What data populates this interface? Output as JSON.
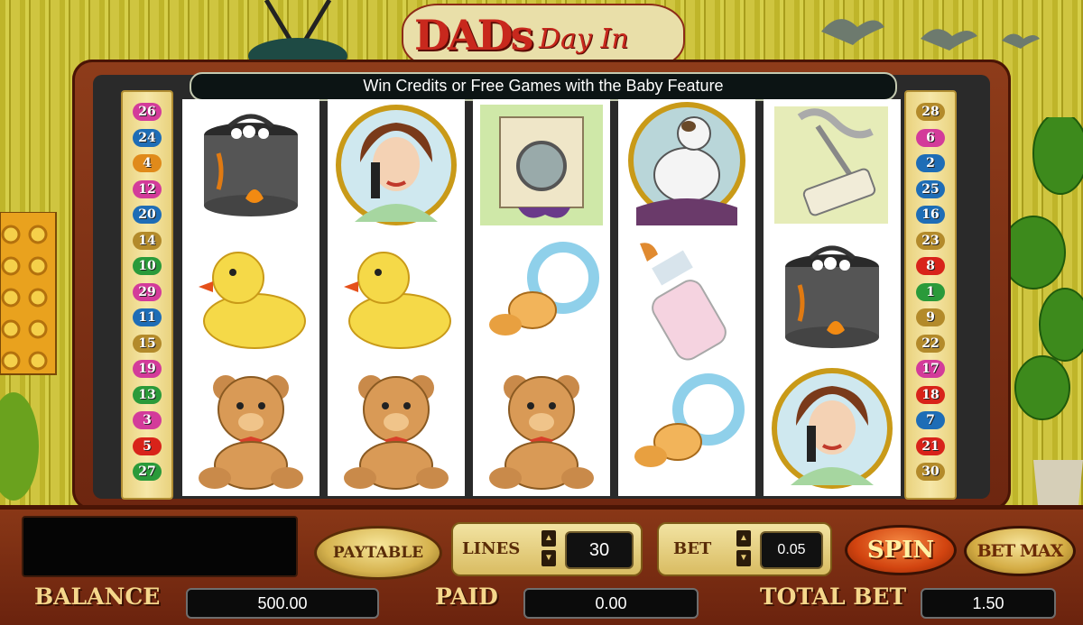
{
  "game": {
    "title_main": "DADs",
    "title_script": "Day In",
    "banner": "Win Credits or Free Games with the Baby Feature"
  },
  "paylines": {
    "left": [
      "26",
      "24",
      "4",
      "12",
      "20",
      "14",
      "10",
      "29",
      "11",
      "15",
      "19",
      "13",
      "3",
      "5",
      "27"
    ],
    "right": [
      "28",
      "6",
      "2",
      "25",
      "16",
      "23",
      "8",
      "1",
      "9",
      "22",
      "17",
      "18",
      "7",
      "21",
      "30"
    ],
    "left_colors": [
      "#d33b9a",
      "#1e6db6",
      "#e08a1a",
      "#d33b9a",
      "#1e6db6",
      "#b38a2a",
      "#2a9a3a",
      "#d33b9a",
      "#1e6db6",
      "#b38a2a",
      "#d33b9a",
      "#2a9a3a",
      "#d33b9a",
      "#d8231a",
      "#2a9a3a"
    ],
    "right_colors": [
      "#b38a2a",
      "#d33b9a",
      "#1e6db6",
      "#1e6db6",
      "#1e6db6",
      "#b38a2a",
      "#d8231a",
      "#2a9a3a",
      "#b38a2a",
      "#b38a2a",
      "#d33b9a",
      "#d8231a",
      "#1e6db6",
      "#d8231a",
      "#b38a2a"
    ]
  },
  "reels": [
    [
      "burning-pot",
      "rubber-duck",
      "teddy-bear"
    ],
    [
      "mom-on-phone",
      "rubber-duck",
      "teddy-bear"
    ],
    [
      "broken-washing-machine",
      "pacifier",
      "teddy-bear"
    ],
    [
      "dog-with-clothes",
      "baby-bottle",
      "pacifier"
    ],
    [
      "vacuum-cleaner",
      "burning-pot",
      "mom-on-phone"
    ]
  ],
  "controls": {
    "paytable_label": "PAYTABLE",
    "lines_label": "LINES",
    "lines_value": "30",
    "bet_label": "BET",
    "bet_value": "0.05",
    "spin_label": "SPIN",
    "betmax_label": "BET MAX",
    "arrow_up": "▲",
    "arrow_down": "▼"
  },
  "footer": {
    "balance_label": "BALANCE",
    "balance_value": "500.00",
    "paid_label": "PAID",
    "paid_value": "0.00",
    "total_bet_label": "TOTAL BET",
    "total_bet_value": "1.50"
  }
}
